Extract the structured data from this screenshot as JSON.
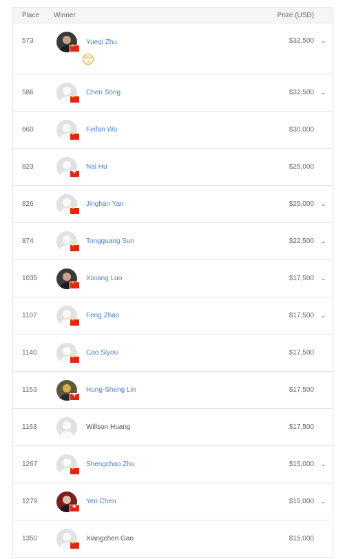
{
  "header": {
    "place": "Place",
    "winner": "Winner",
    "prize": "Prize (USD)"
  },
  "rows": [
    {
      "place": "573",
      "name": "Yueqi Zhu",
      "prize": "$32,500",
      "expandable": true,
      "avatar": "photo",
      "flag": "cn",
      "linked": true,
      "badge": "WSOP 15"
    },
    {
      "place": "586",
      "name": "Chen Song",
      "prize": "$32,500",
      "expandable": true,
      "avatar": "default",
      "flag": "cn",
      "linked": true
    },
    {
      "place": "660",
      "name": "Feifan Wu",
      "prize": "$30,000",
      "expandable": false,
      "avatar": "default",
      "flag": "cn",
      "linked": true
    },
    {
      "place": "823",
      "name": "Nai Hu",
      "prize": "$25,000",
      "expandable": false,
      "avatar": "default",
      "flag": "tw",
      "linked": true
    },
    {
      "place": "826",
      "name": "Jinghan Yan",
      "prize": "$25,000",
      "expandable": true,
      "avatar": "default",
      "flag": "cn",
      "linked": true
    },
    {
      "place": "874",
      "name": "Tongguang Sun",
      "prize": "$22,500",
      "expandable": true,
      "avatar": "default",
      "flag": "cn",
      "linked": true
    },
    {
      "place": "1035",
      "name": "Xixiang Luo",
      "prize": "$17,500",
      "expandable": true,
      "avatar": "photo",
      "flag": "cn",
      "linked": true
    },
    {
      "place": "1107",
      "name": "Feng Zhao",
      "prize": "$17,500",
      "expandable": true,
      "avatar": "default",
      "flag": "cn",
      "linked": true
    },
    {
      "place": "1140",
      "name": "Cao Siyou",
      "prize": "$17,500",
      "expandable": false,
      "avatar": "default",
      "flag": "cn",
      "linked": true
    },
    {
      "place": "1153",
      "name": "Hung-Sheng Lin",
      "prize": "$17,500",
      "expandable": false,
      "avatar": "photo2",
      "flag": "tw",
      "linked": true
    },
    {
      "place": "1163",
      "name": "Willson Huang",
      "prize": "$17,500",
      "expandable": false,
      "avatar": "default",
      "flag": "",
      "linked": false
    },
    {
      "place": "1267",
      "name": "Shengchao Zhu",
      "prize": "$15,000",
      "expandable": true,
      "avatar": "default",
      "flag": "cn",
      "linked": true
    },
    {
      "place": "1279",
      "name": "Yen Chen",
      "prize": "$15,000",
      "expandable": true,
      "avatar": "photo3",
      "flag": "tw",
      "linked": true
    },
    {
      "place": "1350",
      "name": "Xiangchen Gao",
      "prize": "$15,000",
      "expandable": false,
      "avatar": "default",
      "flag": "cn",
      "linked": false
    }
  ],
  "icons": {
    "expand": "chevron-down-icon",
    "flag_cn": "china-flag-icon",
    "flag_tw": "taiwan-flag-icon",
    "badge": "bracelet-badge-icon"
  },
  "colors": {
    "link": "#4a7fc9",
    "text": "#555555",
    "border": "#e3e3e3",
    "header_bg": "#f5f5f5",
    "flag_red": "#de2910"
  }
}
